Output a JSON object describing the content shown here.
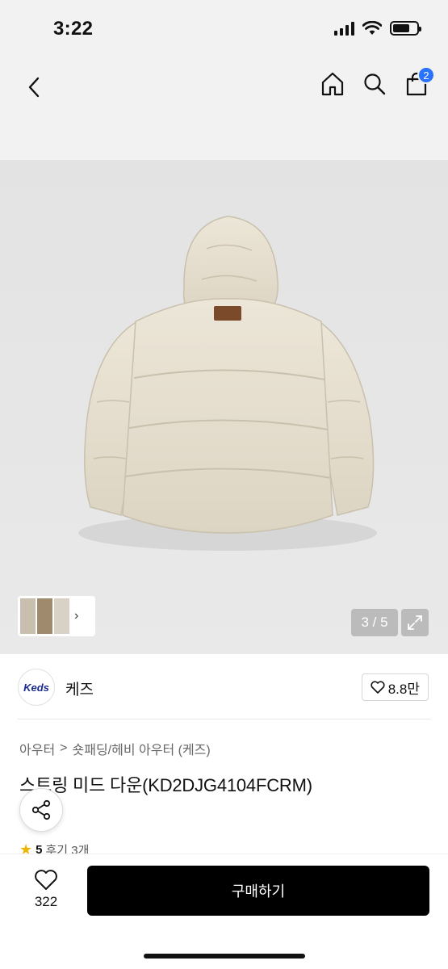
{
  "status_bar": {
    "time": "3:22"
  },
  "nav": {
    "back_icon": "chevron-left-icon",
    "home_icon": "home-icon",
    "search_icon": "search-icon",
    "cart_icon": "shopping-bag-icon",
    "cart_badge": "2",
    "badge_color": "#2a73ff"
  },
  "gallery": {
    "counter": "3 / 5",
    "thumb_arrow": "›",
    "expand_icon": "expand-icon"
  },
  "brand": {
    "logo_text": "Keds",
    "name": "케즈",
    "likes": "8.8만"
  },
  "product": {
    "breadcrumb": [
      "아우터",
      "숏패딩/헤비 아우터 (케즈)"
    ],
    "breadcrumb_separator": ">",
    "title": "스트링 미드 다운(KD2DJG4104FCRM)",
    "rating": "5",
    "reviews": "후기 3개"
  },
  "bottom_bar": {
    "wish_count": "322",
    "buy_label": "구매하기"
  }
}
